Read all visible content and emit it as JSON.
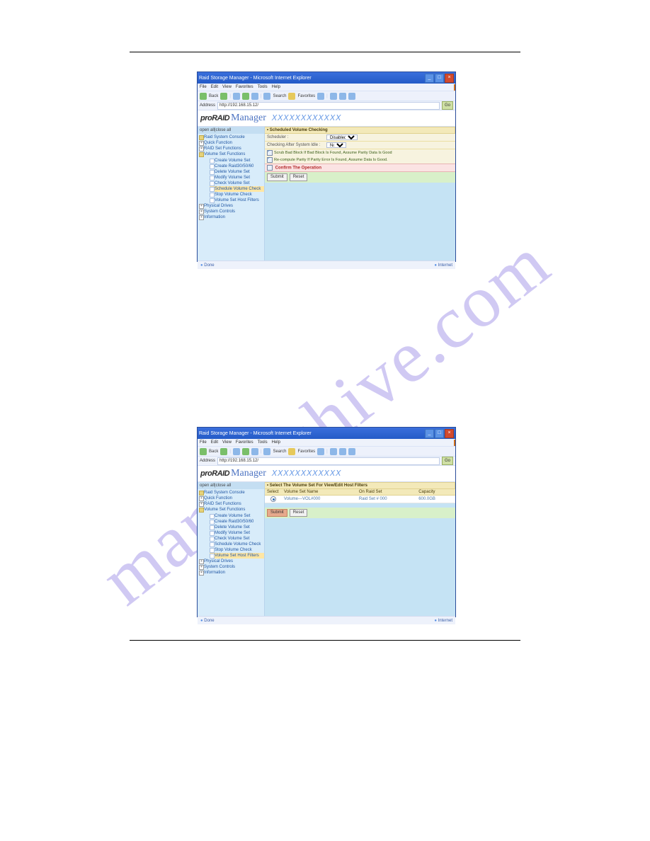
{
  "watermark": "manualshive.com",
  "window": {
    "title": "Raid Storage Manager - Microsoft Internet Explorer",
    "menu": [
      "File",
      "Edit",
      "View",
      "Favorites",
      "Tools",
      "Help"
    ],
    "back": "Back",
    "search": "Search",
    "favorites": "Favorites",
    "addr_label": "Address",
    "address": "http://192.168.15.12/",
    "go": "Go",
    "status_done": "Done",
    "status_zone": "Internet"
  },
  "logo": {
    "pro": "proRAID",
    "mgr": "Manager",
    "xs": "XXXXXXXXXXXX"
  },
  "sidebar": {
    "toggle": "open all|close all",
    "items": {
      "raid_console": "Raid System Console",
      "quick": "Quick Function",
      "raidset": "RAID Set Functions",
      "volset": "Volume Set Functions",
      "create": "Create Volume Set",
      "create_r30": "Create Raid30/50/60",
      "delete": "Delete Volume Set",
      "modify": "Modify Volume Set",
      "check": "Check Volume Set",
      "schedule": "Schedule Volume Check",
      "stop": "Stop Volume Check",
      "filters": "Volume Set Host Filters",
      "pdrives": "Physical Drives",
      "sysctl": "System Controls",
      "info": "Information"
    }
  },
  "shot1": {
    "panel_title": "• Scheduled Volume Checking",
    "scheduler_label": "Scheduler :",
    "scheduler_value": "Disabled",
    "idle_label": "Checking After System Idle :",
    "idle_value": "No",
    "scrub": "Scrub Bad Block If Bad Block Is Found, Assume Parity Data Is Good",
    "recompute": "Re-compute Parity If Parity Error Is Found, Assume Data Is Good.",
    "confirm": "Confirm The Operation",
    "submit": "Submit",
    "reset": "Reset"
  },
  "shot2": {
    "panel_title": "• Select The Volume Set For View/Edit Host Filters",
    "cols": {
      "select": "Select",
      "name": "Volume Set Name",
      "onraid": "On Raid Set",
      "cap": "Capacity"
    },
    "row": {
      "name": "Volume---VOL#000",
      "onraid": "Raid Set # 000",
      "cap": "600.0GB"
    },
    "submit": "Submit",
    "reset": "Reset"
  }
}
